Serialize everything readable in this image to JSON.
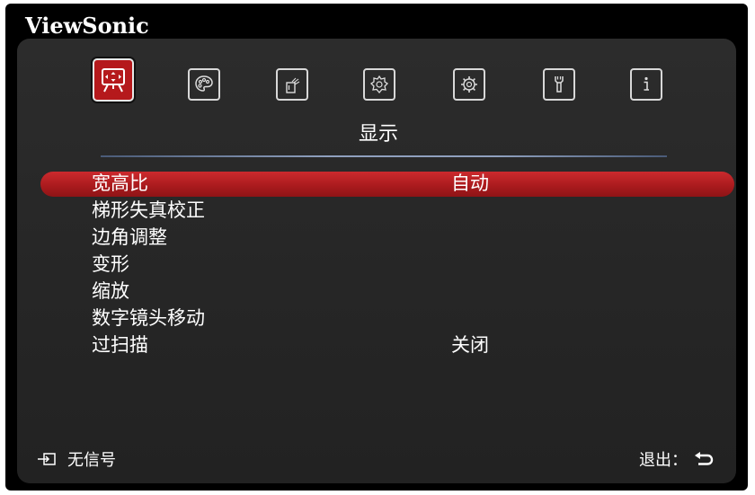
{
  "brand": "ViewSonic",
  "tabs": [
    {
      "icon": "display-icon",
      "active": true
    },
    {
      "icon": "palette-icon",
      "active": false
    },
    {
      "icon": "power-management-icon",
      "active": false
    },
    {
      "icon": "basic-settings-icon",
      "active": false
    },
    {
      "icon": "advanced-settings-icon",
      "active": false
    },
    {
      "icon": "system-wrench-icon",
      "active": false
    },
    {
      "icon": "information-icon",
      "active": false
    }
  ],
  "tab_title": "显示",
  "menu": {
    "items": [
      {
        "label": "宽高比",
        "value": "自动"
      },
      {
        "label": "梯形失真校正",
        "value": ""
      },
      {
        "label": "边角调整",
        "value": ""
      },
      {
        "label": "变形",
        "value": ""
      },
      {
        "label": "缩放",
        "value": ""
      },
      {
        "label": "数字镜头移动",
        "value": ""
      },
      {
        "label": "过扫描",
        "value": "关闭"
      }
    ]
  },
  "footer": {
    "source_status": "无信号",
    "exit_label": "退出："
  },
  "colors": {
    "accent": "#b5191c",
    "panel": "#2a2a2a",
    "frame": "#000000"
  }
}
